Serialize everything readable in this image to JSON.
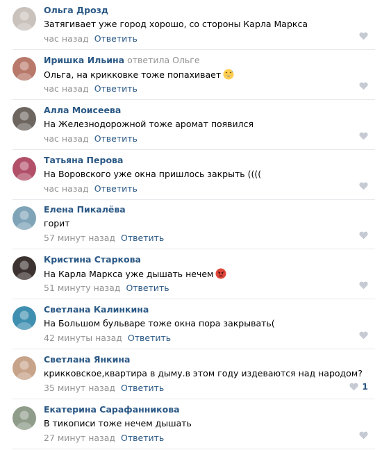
{
  "reply_label": "Ответить",
  "comments": [
    {
      "author": "Ольга Дрозд",
      "reply_to": "",
      "text": "Затягивает уже город хорошо, со стороны Карла Маркса",
      "time": "час назад",
      "likes": "",
      "emoji": "",
      "avatar_color": "#c9c2bc"
    },
    {
      "author": "Иришка Ильина",
      "reply_to": "ответила Ольге",
      "text": "Ольга, на крикковке тоже попахивает",
      "time": "час назад",
      "likes": "",
      "emoji": "grinning-sweat-emoji",
      "avatar_color": "#b8786a"
    },
    {
      "author": "Алла Моисеева",
      "reply_to": "",
      "text": "На Железнодорожной тоже аромат появился",
      "time": "час назад",
      "likes": "",
      "emoji": "",
      "avatar_color": "#6d6660"
    },
    {
      "author": "Татьяна Перова",
      "reply_to": "",
      "text": "На Воровского уже окна пришлось закрыть ((((",
      "time": "час назад",
      "likes": "",
      "emoji": "",
      "avatar_color": "#b2506a"
    },
    {
      "author": "Елена Пикалёва",
      "reply_to": "",
      "text": "горит",
      "time": "57 минут назад",
      "likes": "",
      "emoji": "",
      "avatar_color": "#7fa4b8"
    },
    {
      "author": "Кристина Старкова",
      "reply_to": "",
      "text": "На Карла Маркса уже дышать нечем",
      "time": "51 минуту назад",
      "likes": "",
      "emoji": "angry-face-emoji",
      "avatar_color": "#3c3330"
    },
    {
      "author": "Светлана Калинкина",
      "reply_to": "",
      "text": "На Большом бульваре тоже окна пора закрывать(",
      "time": "42 минуты назад",
      "likes": "",
      "emoji": "",
      "avatar_color": "#3f8fb0"
    },
    {
      "author": "Светлана Янкина",
      "reply_to": "",
      "text": "крикковское,квартира в дыму.в этом году издеваются над народом?",
      "time": "35 минут назад",
      "likes": "1",
      "emoji": "",
      "avatar_color": "#c7a38a"
    },
    {
      "author": "Екатерина Сарафанникова",
      "reply_to": "",
      "text": "В тикописи тоже нечем дышать",
      "time": "27 минут назад",
      "likes": "",
      "emoji": "",
      "avatar_color": "#8f9c8a"
    }
  ]
}
